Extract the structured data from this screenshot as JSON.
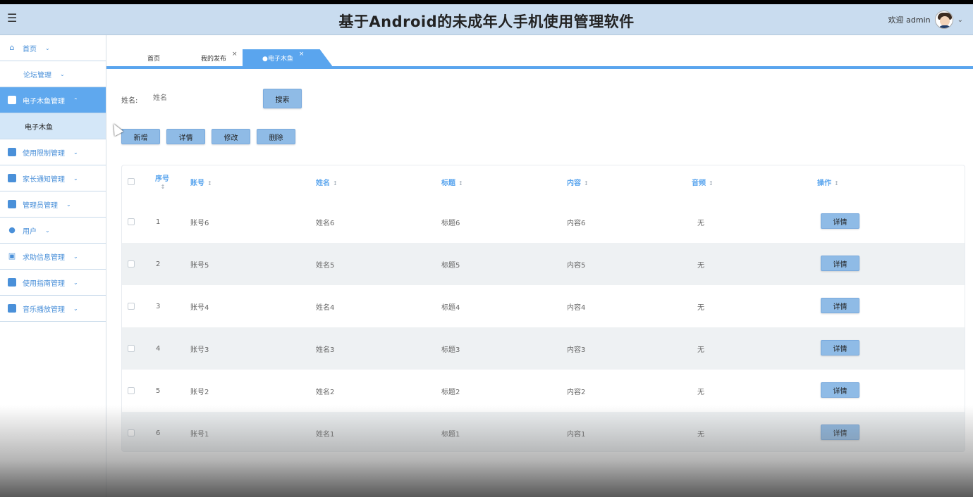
{
  "header": {
    "title": "基于Android的未成年人手机使用管理软件",
    "welcome": "欢迎 admin"
  },
  "sidebar": {
    "items": [
      {
        "label": "首页",
        "icon": "home-icon"
      },
      {
        "label": "论坛管理",
        "icon": ""
      },
      {
        "label": "电子木鱼管理",
        "icon": "image-icon",
        "active": true
      },
      {
        "label": "电子木鱼",
        "child": true
      },
      {
        "label": "使用限制管理",
        "icon": "table-icon"
      },
      {
        "label": "家长通知管理",
        "icon": "columns-icon"
      },
      {
        "label": "管理员管理",
        "icon": "grid-icon"
      },
      {
        "label": "用户",
        "icon": "user-icon"
      },
      {
        "label": "求助信息管理",
        "icon": "chip-icon"
      },
      {
        "label": "使用指南管理",
        "icon": "briefcase-icon"
      },
      {
        "label": "音乐播放管理",
        "icon": "card-icon"
      }
    ]
  },
  "tabs": [
    {
      "label": "首页"
    },
    {
      "label": "我的发布"
    },
    {
      "label": "●电子木鱼"
    }
  ],
  "search": {
    "label": "姓名:",
    "placeholder": "姓名",
    "button": "搜索"
  },
  "actions": {
    "add": "新增",
    "detail": "详情",
    "edit": "修改",
    "delete": "删除"
  },
  "table": {
    "headers": [
      "序号",
      "账号",
      "姓名",
      "标题",
      "内容",
      "音频",
      "操作"
    ],
    "rows": [
      {
        "no": "1",
        "account": "账号6",
        "name": "姓名6",
        "title": "标题6",
        "content": "内容6",
        "audio": "无",
        "op": "详情"
      },
      {
        "no": "2",
        "account": "账号5",
        "name": "姓名5",
        "title": "标题5",
        "content": "内容5",
        "audio": "无",
        "op": "详情"
      },
      {
        "no": "3",
        "account": "账号4",
        "name": "姓名4",
        "title": "标题4",
        "content": "内容4",
        "audio": "无",
        "op": "详情"
      },
      {
        "no": "4",
        "account": "账号3",
        "name": "姓名3",
        "title": "标题3",
        "content": "内容3",
        "audio": "无",
        "op": "详情"
      },
      {
        "no": "5",
        "account": "账号2",
        "name": "姓名2",
        "title": "标题2",
        "content": "内容2",
        "audio": "无",
        "op": "详情"
      },
      {
        "no": "6",
        "account": "账号1",
        "name": "姓名1",
        "title": "标题1",
        "content": "内容1",
        "audio": "无",
        "op": "详情"
      }
    ]
  },
  "colors": {
    "accent": "#5aa5ee",
    "header_bg": "#c9dcef",
    "button": "#8fbbe6"
  }
}
